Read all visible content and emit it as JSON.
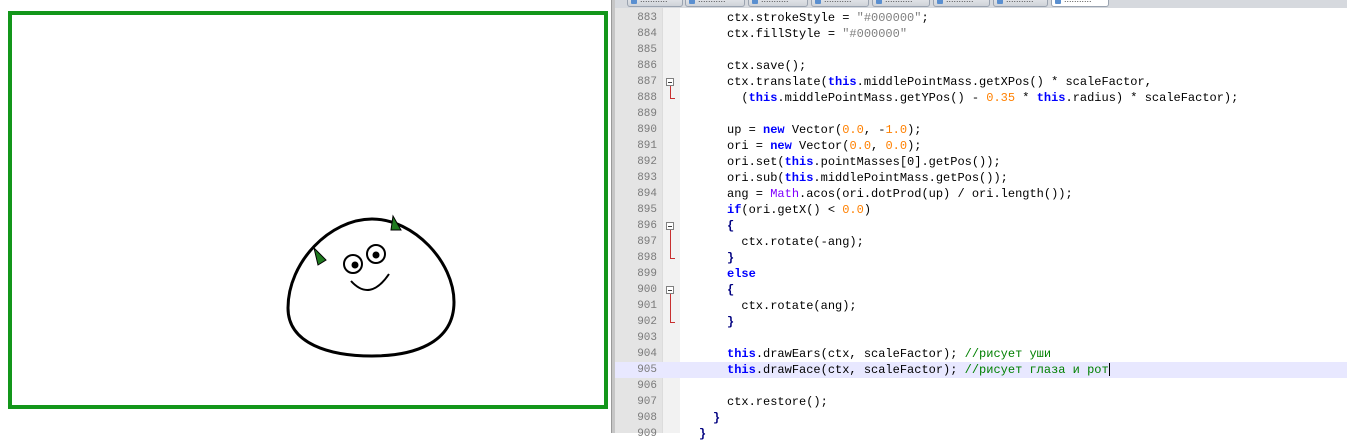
{
  "colors": {
    "frame": "#13961a",
    "ears": "#1f7a1f",
    "keyword": "#0000ff",
    "number": "#ff8000",
    "string": "#808080",
    "comment": "#008000",
    "current_line": "#e8e8ff"
  },
  "canvas": {
    "ears": [
      "ear-left",
      "ear-right"
    ],
    "eyes": [
      "eye-left",
      "eye-right"
    ]
  },
  "tabs": [
    {
      "label": "...........",
      "active": false
    },
    {
      "label": "...........",
      "active": false
    },
    {
      "label": "...........",
      "active": false
    },
    {
      "label": "...........",
      "active": false
    },
    {
      "label": "...........",
      "active": false
    },
    {
      "label": "...........",
      "active": false
    },
    {
      "label": "...........",
      "active": false
    },
    {
      "label": "...........",
      "active": true
    }
  ],
  "editor": {
    "current_line": 905,
    "folds": [
      887,
      896,
      900
    ],
    "lines": [
      {
        "num": "883",
        "tokens": [
          [
            "",
            "ctx.strokeStyle = "
          ],
          [
            "str",
            "\"#000000\""
          ],
          [
            "",
            ";"
          ]
        ]
      },
      {
        "num": "884",
        "tokens": [
          [
            "",
            "ctx.fillStyle = "
          ],
          [
            "str",
            "\"#000000\""
          ]
        ]
      },
      {
        "num": "885",
        "tokens": []
      },
      {
        "num": "886",
        "tokens": [
          [
            "",
            "ctx.save();"
          ]
        ]
      },
      {
        "num": "887",
        "tokens": [
          [
            "",
            "ctx.translate("
          ],
          [
            "kw",
            "this"
          ],
          [
            "",
            ".middlePointMass.getXPos() * scaleFactor,"
          ]
        ]
      },
      {
        "num": "888",
        "tokens": [
          [
            "",
            "  ("
          ],
          [
            "kw",
            "this"
          ],
          [
            "",
            ".middlePointMass.getYPos() - "
          ],
          [
            "num",
            "0.35"
          ],
          [
            "",
            " * "
          ],
          [
            "kw",
            "this"
          ],
          [
            "",
            ".radius) * scaleFactor);"
          ]
        ]
      },
      {
        "num": "889",
        "tokens": []
      },
      {
        "num": "890",
        "tokens": [
          [
            "",
            "up = "
          ],
          [
            "kw",
            "new"
          ],
          [
            "",
            " Vector("
          ],
          [
            "num",
            "0.0"
          ],
          [
            "",
            ", -"
          ],
          [
            "num",
            "1.0"
          ],
          [
            "",
            ");"
          ]
        ]
      },
      {
        "num": "891",
        "tokens": [
          [
            "",
            "ori = "
          ],
          [
            "kw",
            "new"
          ],
          [
            "",
            " Vector("
          ],
          [
            "num",
            "0.0"
          ],
          [
            "",
            ", "
          ],
          [
            "num",
            "0.0"
          ],
          [
            "",
            ");"
          ]
        ]
      },
      {
        "num": "892",
        "tokens": [
          [
            "",
            "ori.set("
          ],
          [
            "kw",
            "this"
          ],
          [
            "",
            ".pointMasses[0].getPos());"
          ]
        ]
      },
      {
        "num": "893",
        "tokens": [
          [
            "",
            "ori.sub("
          ],
          [
            "kw",
            "this"
          ],
          [
            "",
            ".middlePointMass.getPos());"
          ]
        ]
      },
      {
        "num": "894",
        "tokens": [
          [
            "",
            "ang = "
          ],
          [
            "obj",
            "Math"
          ],
          [
            "",
            ".acos(ori.dotProd(up) / ori.length());"
          ]
        ]
      },
      {
        "num": "895",
        "tokens": [
          [
            "kw",
            "if"
          ],
          [
            "",
            "(ori.getX() < "
          ],
          [
            "num",
            "0.0"
          ],
          [
            "",
            ")"
          ]
        ]
      },
      {
        "num": "896",
        "tokens": [
          [
            "op",
            "{"
          ]
        ]
      },
      {
        "num": "897",
        "tokens": [
          [
            "",
            "  ctx.rotate(-ang);"
          ]
        ]
      },
      {
        "num": "898",
        "tokens": [
          [
            "op",
            "}"
          ]
        ]
      },
      {
        "num": "899",
        "tokens": [
          [
            "kw",
            "else"
          ]
        ]
      },
      {
        "num": "900",
        "tokens": [
          [
            "op",
            "{"
          ]
        ]
      },
      {
        "num": "901",
        "tokens": [
          [
            "",
            "  ctx.rotate(ang);"
          ]
        ]
      },
      {
        "num": "902",
        "tokens": [
          [
            "op",
            "}"
          ]
        ]
      },
      {
        "num": "903",
        "tokens": []
      },
      {
        "num": "904",
        "tokens": [
          [
            "kw",
            "this"
          ],
          [
            "",
            ".drawEars(ctx, scaleFactor); "
          ],
          [
            "cm",
            "//рисует уши"
          ]
        ]
      },
      {
        "num": "905",
        "tokens": [
          [
            "kw",
            "this"
          ],
          [
            "",
            ".drawFace(ctx, scaleFactor); "
          ],
          [
            "cm",
            "//рисует глаза и рот"
          ]
        ]
      },
      {
        "num": "906",
        "tokens": []
      },
      {
        "num": "907",
        "tokens": [
          [
            "",
            "ctx.restore();"
          ]
        ]
      },
      {
        "num": "908",
        "tokens": [
          [
            "op",
            "}"
          ]
        ]
      },
      {
        "num": "909",
        "tokens": [
          [
            "op",
            "}"
          ]
        ]
      }
    ]
  }
}
